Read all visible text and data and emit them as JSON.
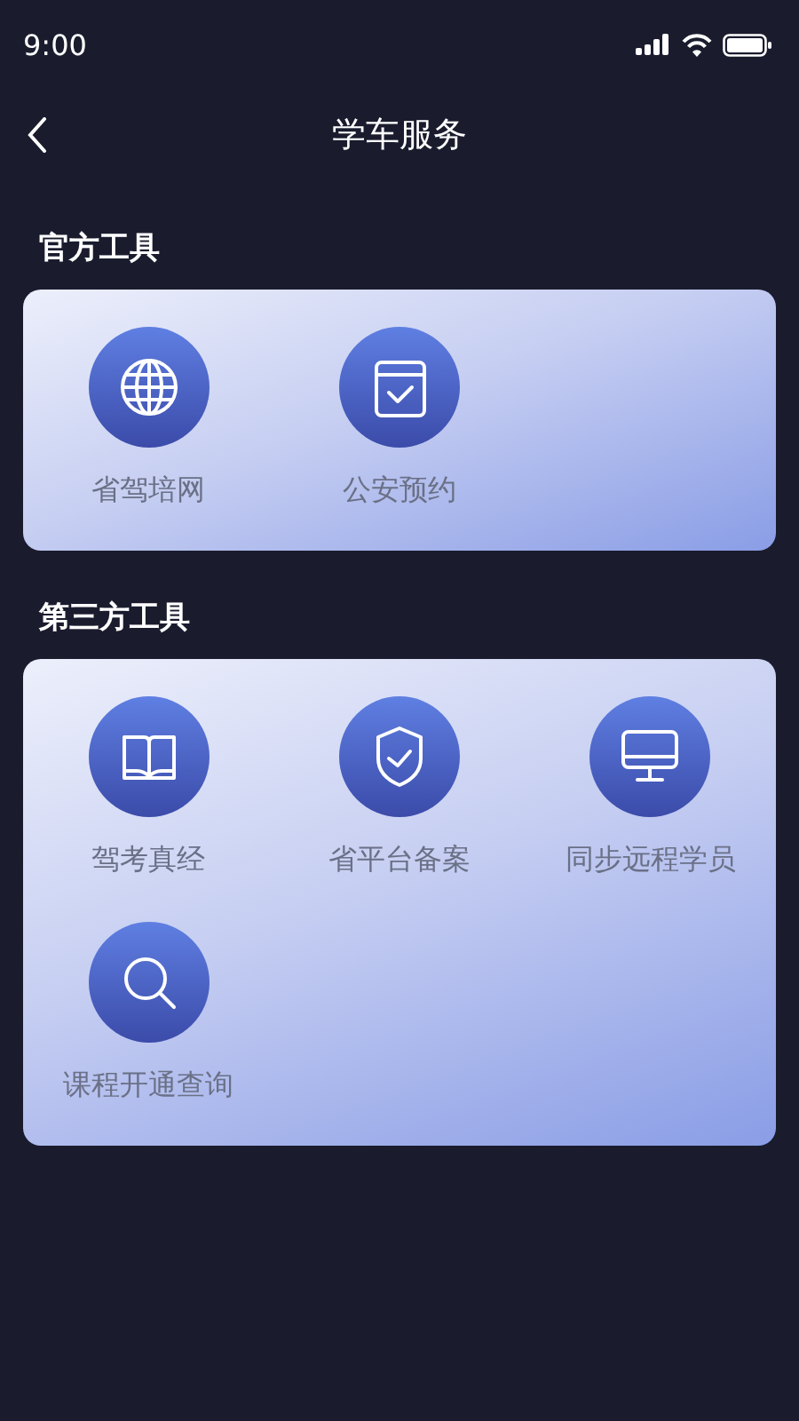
{
  "status_bar": {
    "time": "9:00"
  },
  "header": {
    "title": "学车服务"
  },
  "sections": [
    {
      "title": "官方工具",
      "items": [
        {
          "label": "省驾培网"
        },
        {
          "label": "公安预约"
        }
      ]
    },
    {
      "title": "第三方工具",
      "items": [
        {
          "label": "驾考真经"
        },
        {
          "label": "省平台备案"
        },
        {
          "label": "同步远程学员"
        },
        {
          "label": "课程开通查询"
        }
      ]
    }
  ]
}
